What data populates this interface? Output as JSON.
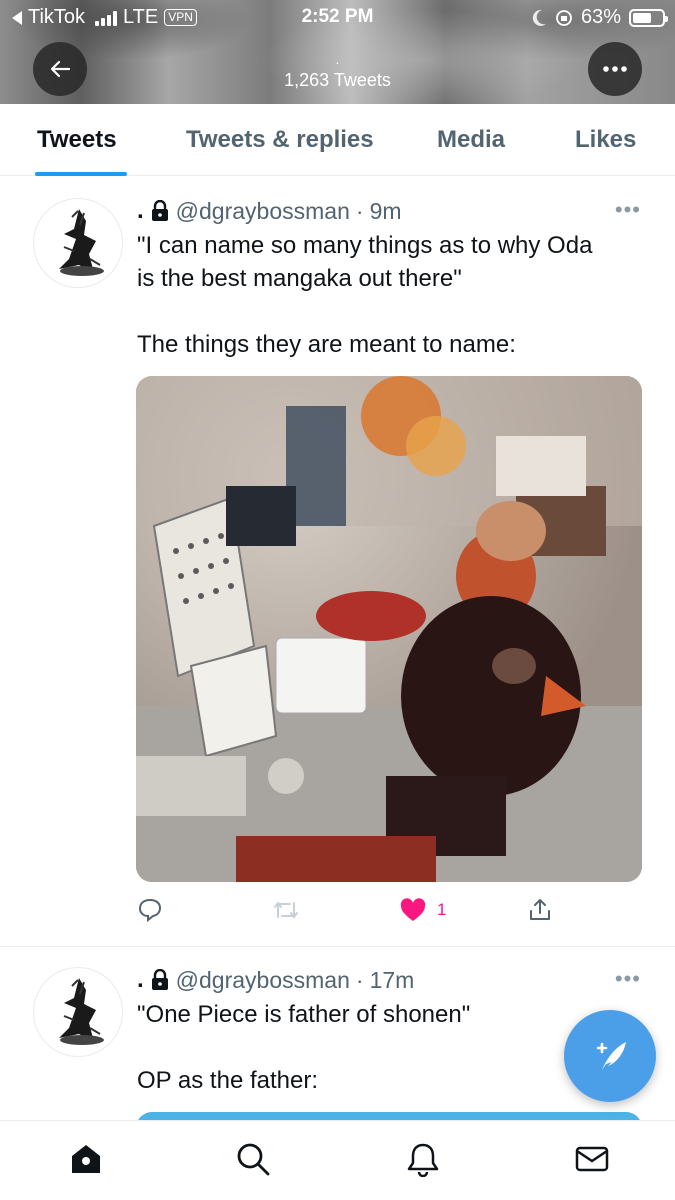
{
  "status_bar": {
    "back_app": "TikTok",
    "network": "LTE",
    "vpn": "VPN",
    "time": "2:52 PM",
    "battery": "63%",
    "battery_level": 0.63
  },
  "header": {
    "dot": ".",
    "tweet_count": "1,263 Tweets"
  },
  "tabs": [
    {
      "label": "Tweets",
      "active": true
    },
    {
      "label": "Tweets & replies",
      "active": false
    },
    {
      "label": "Media",
      "active": false
    },
    {
      "label": "Likes",
      "active": false
    }
  ],
  "tweets": [
    {
      "display_name": ".",
      "handle": "@dgraybossman",
      "separator": "·",
      "time": "9m",
      "menu": "•••",
      "text_line1": "\"I can name so many things as to why Oda",
      "text_line2": "is the best mangaka out there\"",
      "text_line3": "The things they are meant to name:",
      "like_count": "1"
    },
    {
      "display_name": ".",
      "handle": "@dgraybossman",
      "separator": "·",
      "time": "17m",
      "menu": "•••",
      "text_line1": "\"One Piece is father of shonen\"",
      "text_line2": "OP as the father:"
    }
  ],
  "colors": {
    "accent": "#1d9bf0",
    "like": "#f91880",
    "fab": "#4a9fe8",
    "muted": "#536471"
  }
}
